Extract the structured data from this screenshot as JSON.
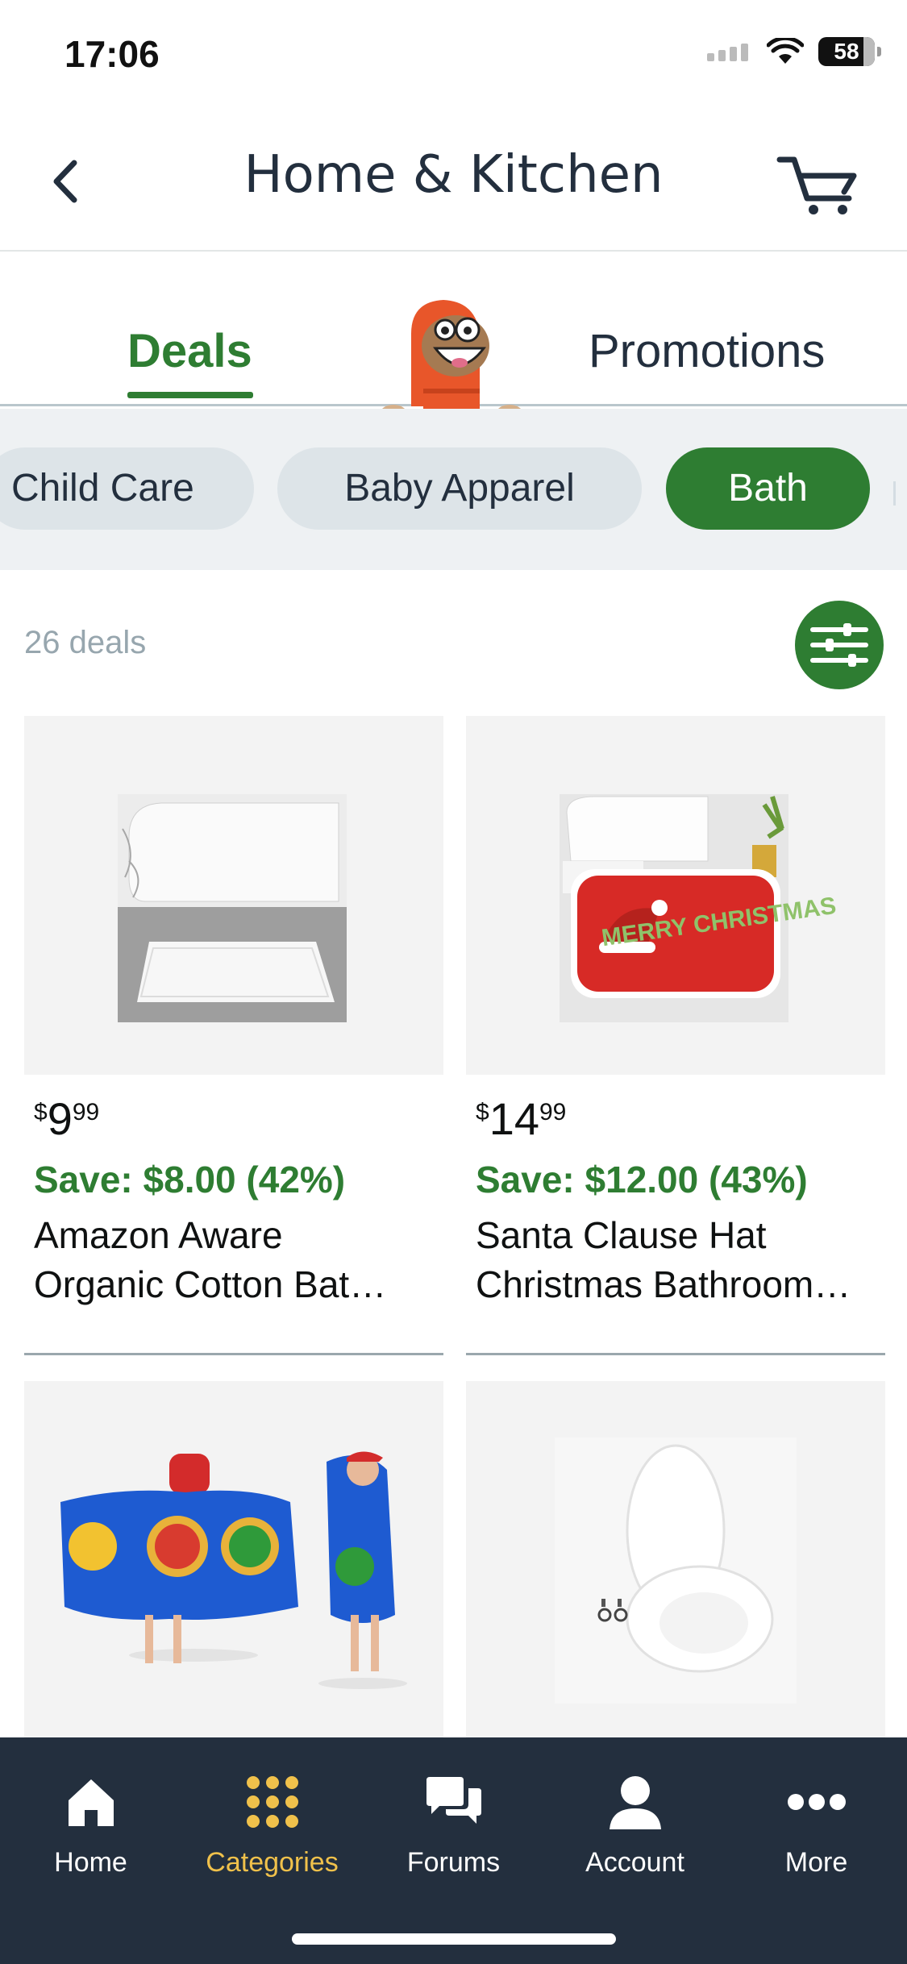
{
  "status_bar": {
    "time": "17:06",
    "battery": "58"
  },
  "nav": {
    "title": "Home & Kitchen"
  },
  "tabs": {
    "deals": "Deals",
    "promotions": "Promotions"
  },
  "chips": [
    {
      "label": "Child Care",
      "active": false
    },
    {
      "label": "Baby Apparel",
      "active": false
    },
    {
      "label": "Bath",
      "active": true
    }
  ],
  "deals_count": "26 deals",
  "products": [
    {
      "currency": "$",
      "price_whole": "9",
      "price_fraction": "99",
      "save": "Save: $8.00 (42%)",
      "name_line1": "Amazon Aware",
      "name_line2": "Organic Cotton Bat…"
    },
    {
      "currency": "$",
      "price_whole": "14",
      "price_fraction": "99",
      "save": "Save: $12.00 (43%)",
      "name_line1": "Santa Clause Hat",
      "name_line2": "Christmas Bathroom…"
    },
    {
      "image_alt": "Super Mario hooded towel"
    },
    {
      "image_alt": "White toilet seat"
    }
  ],
  "product_image_text": {
    "rug_text": "MERRY CHRISTMAS"
  },
  "tab_bar": [
    {
      "label": "Home",
      "icon": "home-icon",
      "active": false
    },
    {
      "label": "Categories",
      "icon": "grid-icon",
      "active": true
    },
    {
      "label": "Forums",
      "icon": "chat-bubbles-icon",
      "active": false
    },
    {
      "label": "Account",
      "icon": "person-icon",
      "active": false
    },
    {
      "label": "More",
      "icon": "more-dots-icon",
      "active": false
    }
  ],
  "colors": {
    "accent_green": "#2e7d32",
    "tab_bar_bg": "#232f3e",
    "tab_active": "#f0c14b"
  }
}
